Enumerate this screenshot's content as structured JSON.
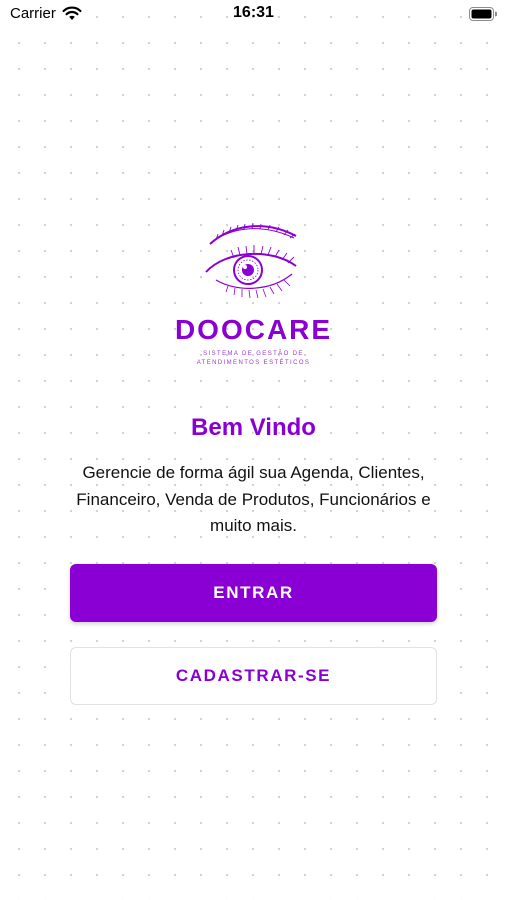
{
  "status_bar": {
    "carrier": "Carrier",
    "time": "16:31"
  },
  "logo": {
    "brand": "DOOCARE",
    "tagline": "Sistema de Gestão de Atendimentos Estéticos"
  },
  "welcome": {
    "title": "Bem Vindo",
    "description": "Gerencie de forma ágil sua Agenda, Clientes, Financeiro, Venda de Produtos, Funcionários e muito mais."
  },
  "actions": {
    "login_label": "ENTRAR",
    "signup_label": "CADASTRAR-SE"
  },
  "colors": {
    "accent": "#8a00d4",
    "background": "#ffffff"
  },
  "icons": {
    "wifi": "wifi-icon",
    "battery": "battery-icon",
    "logo": "eye-logo-icon"
  }
}
